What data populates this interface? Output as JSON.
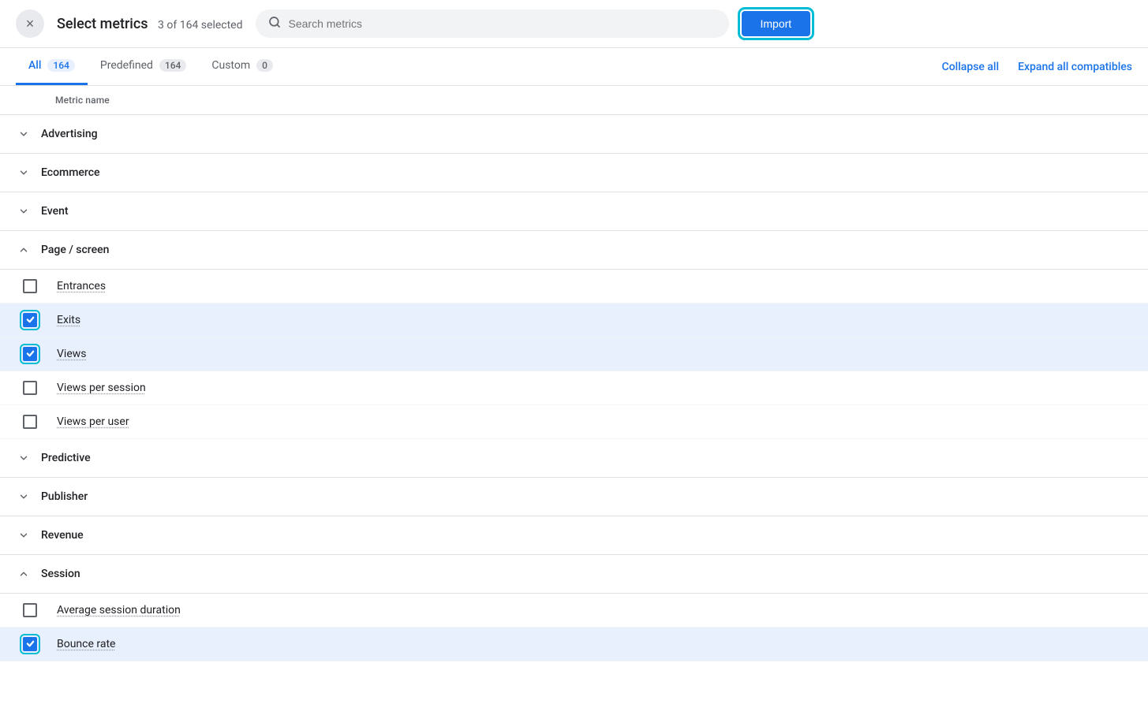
{
  "header": {
    "title": "Select metrics",
    "count": "3 of 164 selected",
    "search_placeholder": "Search metrics",
    "import_label": "Import",
    "close_icon": "×"
  },
  "tabs": {
    "items": [
      {
        "id": "all",
        "label": "All",
        "badge": "164",
        "active": true
      },
      {
        "id": "predefined",
        "label": "Predefined",
        "badge": "164",
        "active": false
      },
      {
        "id": "custom",
        "label": "Custom",
        "badge": "0",
        "active": false
      }
    ],
    "collapse_all": "Collapse all",
    "expand_all": "Expand all compatibles"
  },
  "table_header": {
    "metric_name": "Metric name"
  },
  "rows": [
    {
      "type": "category",
      "label": "Advertising",
      "expanded": false
    },
    {
      "type": "category",
      "label": "Ecommerce",
      "expanded": false
    },
    {
      "type": "category",
      "label": "Event",
      "expanded": false
    },
    {
      "type": "category",
      "label": "Page / screen",
      "expanded": true
    },
    {
      "type": "metric",
      "label": "Entrances",
      "checked": false,
      "focused": false
    },
    {
      "type": "metric",
      "label": "Exits",
      "checked": true,
      "focused": true
    },
    {
      "type": "metric",
      "label": "Views",
      "checked": true,
      "focused": true
    },
    {
      "type": "metric",
      "label": "Views per session",
      "checked": false,
      "focused": false
    },
    {
      "type": "metric",
      "label": "Views per user",
      "checked": false,
      "focused": false
    },
    {
      "type": "category",
      "label": "Predictive",
      "expanded": false
    },
    {
      "type": "category",
      "label": "Publisher",
      "expanded": false
    },
    {
      "type": "category",
      "label": "Revenue",
      "expanded": false
    },
    {
      "type": "category",
      "label": "Session",
      "expanded": true
    },
    {
      "type": "metric",
      "label": "Average session duration",
      "checked": false,
      "focused": false
    },
    {
      "type": "metric",
      "label": "Bounce rate",
      "checked": true,
      "focused": true
    }
  ]
}
